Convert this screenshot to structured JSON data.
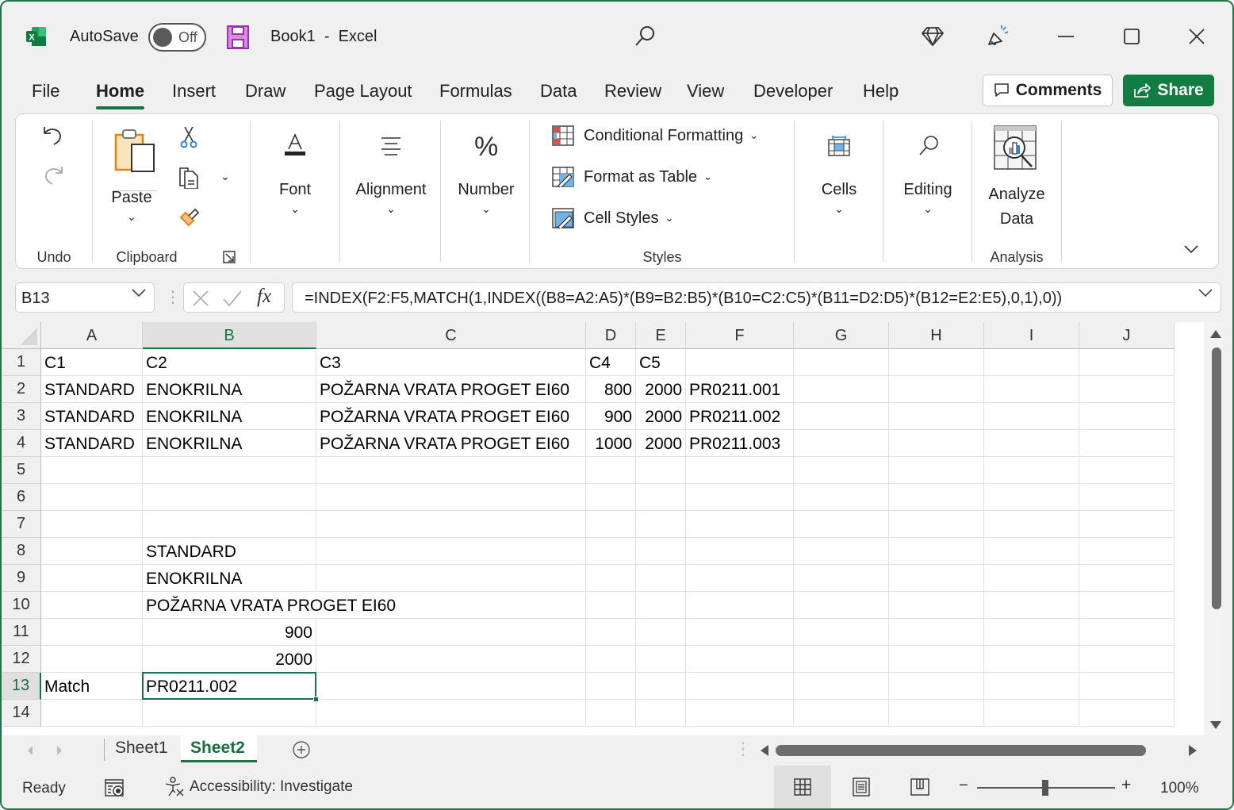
{
  "titlebar": {
    "autosave_label": "AutoSave",
    "autosave_state": "Off",
    "document_title": "Book1  -  Excel",
    "minimize": "—",
    "restore": "☐",
    "close": "✕"
  },
  "menu": {
    "tabs": [
      "File",
      "Home",
      "Insert",
      "Draw",
      "Page Layout",
      "Formulas",
      "Data",
      "Review",
      "View",
      "Developer",
      "Help"
    ],
    "active_tab": "Home",
    "comments_label": "Comments",
    "share_label": "Share",
    "accent_color": "#137c43"
  },
  "ribbon": {
    "groups": {
      "undo": "Undo",
      "clipboard": "Clipboard",
      "styles": "Styles",
      "analysis": "Analysis"
    },
    "paste_label": "Paste",
    "font_label": "Font",
    "alignment_label": "Alignment",
    "number_label": "Number",
    "conditional_formatting_label": "Conditional Formatting",
    "format_as_table_label": "Format as Table",
    "cell_styles_label": "Cell Styles",
    "cells_label": "Cells",
    "editing_label": "Editing",
    "analyze_data_label_1": "Analyze",
    "analyze_data_label_2": "Data"
  },
  "formula_bar": {
    "name_box": "B13",
    "formula": "=INDEX(F2:F5,MATCH(1,INDEX((B8=A2:A5)*(B9=B2:B5)*(B10=C2:C5)*(B11=D2:D5)*(B12=E2:E5),0,1),0))"
  },
  "sheet": {
    "columns": [
      "A",
      "B",
      "C",
      "D",
      "E",
      "F",
      "G",
      "H",
      "I",
      "J"
    ],
    "selected_column": "B",
    "rows": [
      "1",
      "2",
      "3",
      "4",
      "5",
      "6",
      "7",
      "8",
      "9",
      "10",
      "11",
      "12",
      "13",
      "14"
    ],
    "selected_row": "13",
    "cells": {
      "A1": "C1",
      "B1": "C2",
      "C1": "C3",
      "D1": "C4",
      "E1": "C5",
      "A2": "STANDARD",
      "B2": "ENOKRILNA",
      "C2": "POŽARNA VRATA PROGET EI60",
      "D2": "800",
      "E2": "2000",
      "F2": "PR0211.001",
      "A3": "STANDARD",
      "B3": "ENOKRILNA",
      "C3": "POŽARNA VRATA PROGET EI60",
      "D3": "900",
      "E3": "2000",
      "F3": "PR0211.002",
      "A4": "STANDARD",
      "B4": "ENOKRILNA",
      "C4": "POŽARNA VRATA PROGET EI60",
      "D4": "1000",
      "E4": "2000",
      "F4": "PR0211.003",
      "B8": "STANDARD",
      "B9": "ENOKRILNA",
      "B10": "POŽARNA VRATA PROGET EI60",
      "B11": "900",
      "B12": "2000",
      "A13": "Match",
      "B13": "PR0211.002"
    },
    "selected_cell": "B13"
  },
  "sheet_tabs": {
    "tabs": [
      "Sheet1",
      "Sheet2"
    ],
    "active": "Sheet2"
  },
  "status": {
    "ready": "Ready",
    "accessibility": "Accessibility: Investigate",
    "zoom_minus": "−",
    "zoom_plus": "+",
    "zoom_level": "100%"
  }
}
